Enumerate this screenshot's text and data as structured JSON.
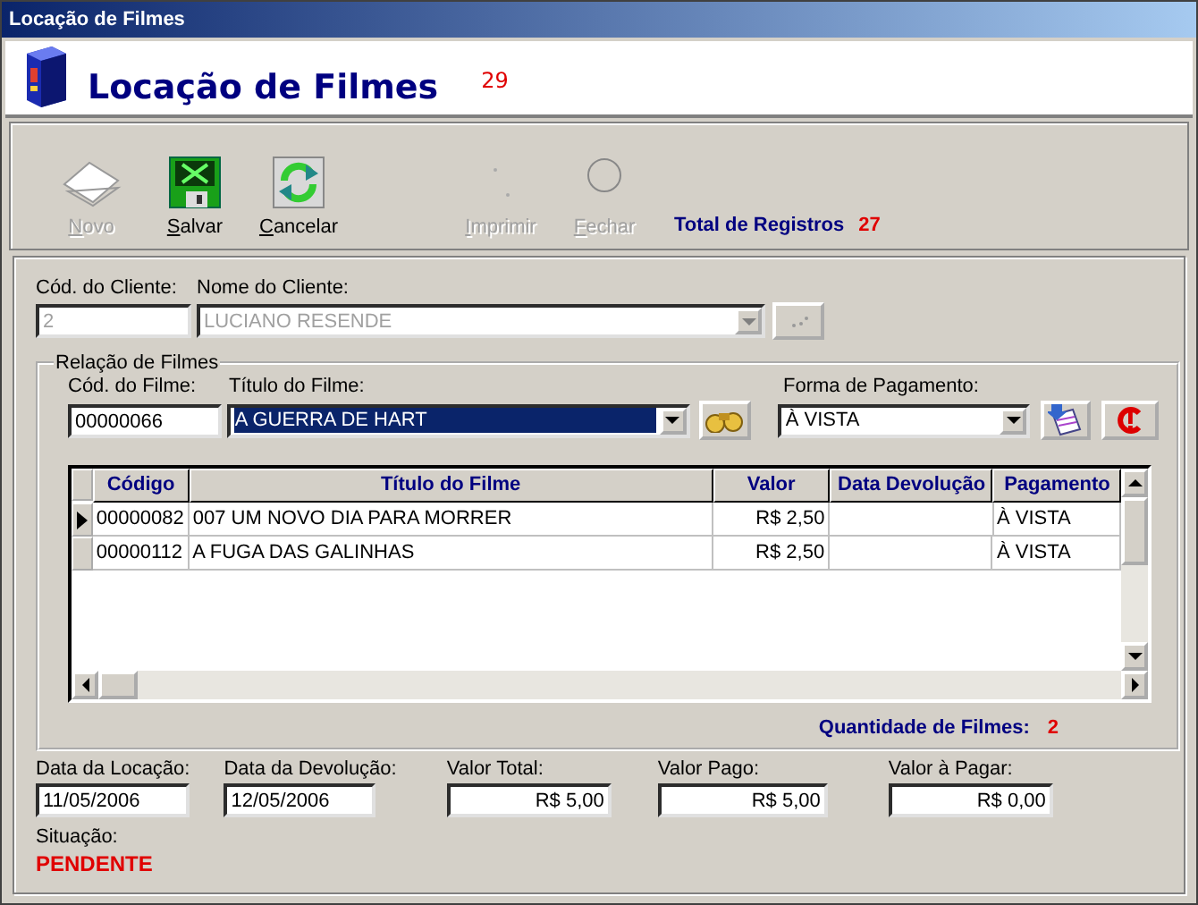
{
  "window": {
    "title": "Locação de Filmes"
  },
  "header": {
    "title": "Locação de Filmes",
    "count": "29"
  },
  "toolbar": {
    "buttons": [
      {
        "label": "Novo",
        "kind": "paper",
        "disabled": true
      },
      {
        "label": "Salvar",
        "kind": "disk",
        "disabled": false
      },
      {
        "label": "Cancelar",
        "kind": "refresh",
        "disabled": false
      },
      {
        "label": "Imprimir",
        "kind": "printer",
        "disabled": true
      },
      {
        "label": "Fechar",
        "kind": "circle",
        "disabled": true
      }
    ],
    "total_label": "Total de Registros",
    "total_count": "27"
  },
  "client": {
    "code_label": "Cód. do Cliente:",
    "code_value": "2",
    "name_label": "Nome do Cliente:",
    "name_value": "LUCIANO RESENDE",
    "disabled": true
  },
  "films": {
    "title": "Relação de Filmes",
    "code_label": "Cód. do Filme:",
    "code_value": "00000066",
    "title_label": "Título do Filme:",
    "title_value": "A GUERRA DE HART",
    "payment_label": "Forma de Pagamento:",
    "payment_value": "À VISTA"
  },
  "table": {
    "columns": [
      "Código",
      "Título do Filme",
      "Valor",
      "Data Devolução",
      "Pagamento"
    ],
    "rows": [
      {
        "cells": [
          "00000082",
          "007 UM NOVO DIA PARA MORRER",
          "R$ 2,50",
          "",
          "À VISTA"
        ],
        "selected": true
      },
      {
        "cells": [
          "00000112",
          "A FUGA DAS GALINHAS",
          "R$ 2,50",
          "",
          "À VISTA"
        ],
        "selected": false
      }
    ]
  },
  "quantity": {
    "label": "Quantidade de Filmes:",
    "count": "2"
  },
  "totals": [
    {
      "label": "Data da Locação:",
      "value": "11/05/2006",
      "kind": "date"
    },
    {
      "label": "Data da Devolução:",
      "value": "12/05/2006",
      "kind": "date"
    },
    {
      "label": "Valor Total:",
      "value": "R$ 5,00",
      "kind": "money"
    },
    {
      "label": "Valor Pago:",
      "value": "R$ 5,00",
      "kind": "money"
    },
    {
      "label": "Valor à Pagar:",
      "value": "R$ 0,00",
      "kind": "money"
    }
  ],
  "status": {
    "label": "Situação:",
    "value": "PENDENTE"
  }
}
